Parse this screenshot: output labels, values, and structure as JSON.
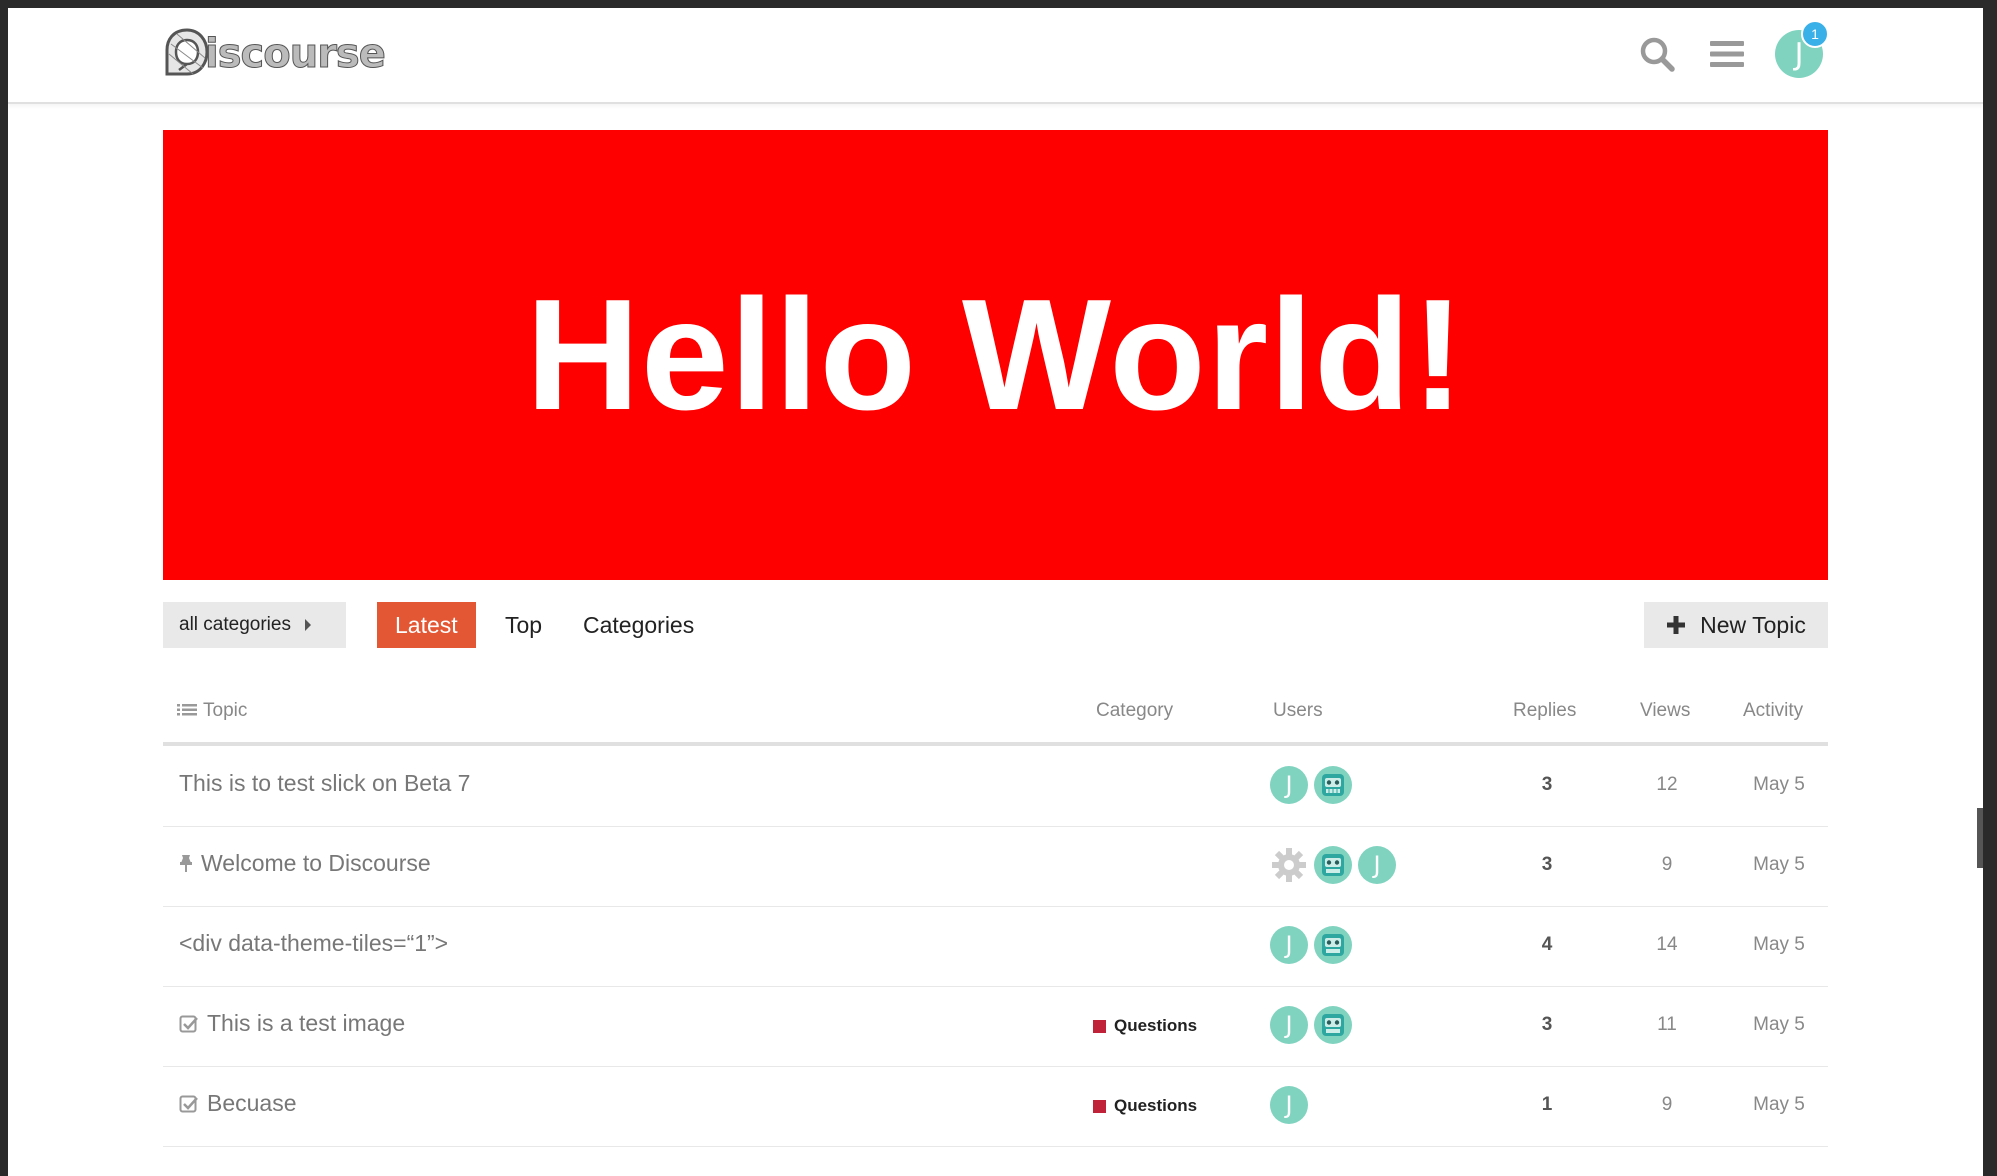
{
  "header": {
    "logo_text": "iscourse",
    "notification_count": "1",
    "user_initial": "J"
  },
  "banner": {
    "text": "Hello World!"
  },
  "nav": {
    "category_dropdown": "all categories",
    "tabs": [
      {
        "label": "Latest",
        "active": true
      },
      {
        "label": "Top",
        "active": false
      },
      {
        "label": "Categories",
        "active": false
      }
    ],
    "new_topic": "New Topic"
  },
  "table": {
    "headers": {
      "topic": "Topic",
      "category": "Category",
      "users": "Users",
      "replies": "Replies",
      "views": "Views",
      "activity": "Activity"
    },
    "rows": [
      {
        "title": "This is to test slick on Beta 7",
        "icon": "",
        "category": "",
        "users": [
          "J",
          "bot"
        ],
        "replies": "3",
        "views": "12",
        "activity": "May 5"
      },
      {
        "title": "Welcome to Discourse",
        "icon": "pin-icon",
        "category": "",
        "users": [
          "gear",
          "bot",
          "J"
        ],
        "replies": "3",
        "views": "9",
        "activity": "May 5"
      },
      {
        "title": "<div data-theme-tiles=“1”>",
        "icon": "",
        "category": "",
        "users": [
          "J",
          "bot"
        ],
        "replies": "4",
        "views": "14",
        "activity": "May 5"
      },
      {
        "title": "This is a test image",
        "icon": "check-square-icon",
        "category": "Questions",
        "users": [
          "J",
          "bot"
        ],
        "replies": "3",
        "views": "11",
        "activity": "May 5"
      },
      {
        "title": "Becuase",
        "icon": "check-square-icon",
        "category": "Questions",
        "users": [
          "J"
        ],
        "replies": "1",
        "views": "9",
        "activity": "May 5"
      }
    ]
  },
  "colors": {
    "banner": "#ff0000",
    "accent": "#e45735",
    "avatar": "#7fd3bf",
    "category_questions": "#c0223a",
    "notification": "#3ab0e8"
  }
}
